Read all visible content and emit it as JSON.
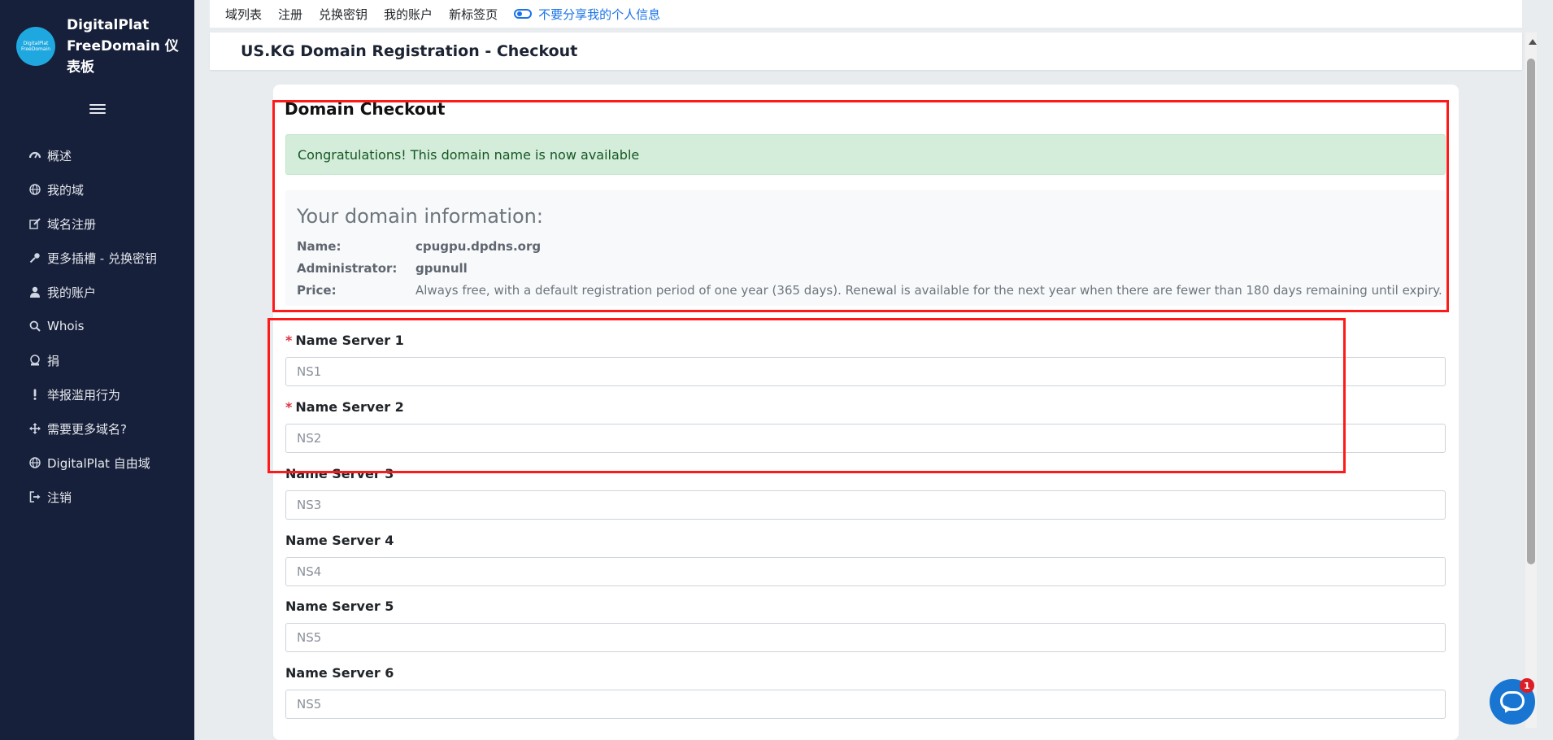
{
  "sidebar": {
    "logo_text_1": "DigitalPlat",
    "logo_text_2": "FreeDomain",
    "brand_title": "DigitalPlat FreeDomain 仪表板",
    "items": [
      {
        "label": "概述",
        "icon": "dashboard-icon"
      },
      {
        "label": "我的域",
        "icon": "globe-icon"
      },
      {
        "label": "域名注册",
        "icon": "edit-icon"
      },
      {
        "label": "更多插槽 - 兑换密钥",
        "icon": "key-icon"
      },
      {
        "label": "我的账户",
        "icon": "user-icon"
      },
      {
        "label": "Whois",
        "icon": "search-icon"
      },
      {
        "label": "捐",
        "icon": "donate-icon"
      },
      {
        "label": "举报滥用行为",
        "icon": "exclamation-icon"
      },
      {
        "label": "需要更多域名?",
        "icon": "arrows-icon"
      },
      {
        "label": "DigitalPlat 自由域",
        "icon": "globe-icon"
      },
      {
        "label": "注销",
        "icon": "logout-icon"
      }
    ]
  },
  "topbar": {
    "links": [
      "域列表",
      "注册",
      "兑换密钥",
      "我的账户",
      "新标签页"
    ],
    "privacy_label": "不要分享我的个人信息"
  },
  "page_header": {
    "title": "US.KG Domain Registration - Checkout"
  },
  "checkout": {
    "title": "Domain Checkout",
    "alert": "Congratulations! This domain name is now available",
    "info_heading": "Your domain information:",
    "name_label": "Name:",
    "name_value": "cpugpu.dpdns.org",
    "admin_label": "Administrator:",
    "admin_value": "gpunull",
    "price_label": "Price:",
    "price_value": "Always free, with a default registration period of one year (365 days). Renewal is available for the next year when there are fewer than 180 days remaining until expiry."
  },
  "form": {
    "required_mark": "*",
    "fields": [
      {
        "label": "Name Server 1",
        "placeholder": "NS1"
      },
      {
        "label": "Name Server 2",
        "placeholder": "NS2"
      },
      {
        "label": "Name Server 3",
        "placeholder": "NS3"
      },
      {
        "label": "Name Server 4",
        "placeholder": "NS4"
      },
      {
        "label": "Name Server 5",
        "placeholder": "NS5"
      },
      {
        "label": "Name Server 6",
        "placeholder": "NS5"
      }
    ]
  },
  "chat": {
    "badge_count": "1"
  },
  "colors": {
    "sidebar_bg": "#17203a",
    "highlight": "#ff1a1a",
    "link_blue": "#1a73e8",
    "success_bg": "#d4edda"
  }
}
